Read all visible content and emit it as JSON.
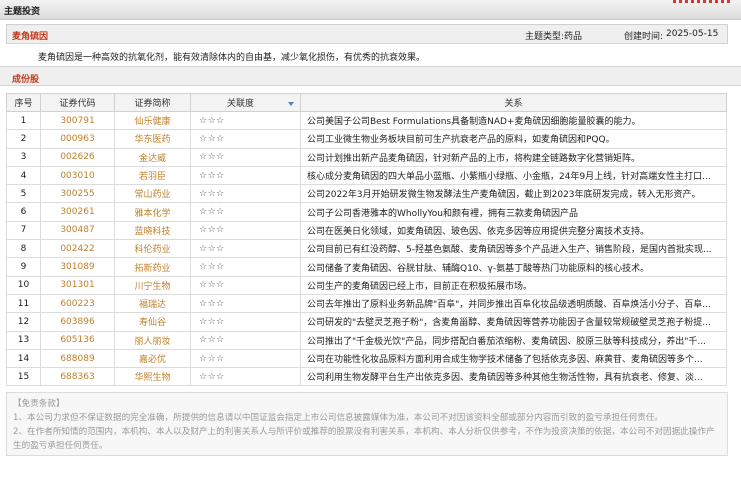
{
  "window": {
    "title": "主题投资"
  },
  "topic": {
    "name": "麦角硫因",
    "type_label": "主题类型:",
    "type_value": "药品",
    "date_label": "创建时间:",
    "date_value": "2025-05-15",
    "description": "麦角硫因是一种高效的抗氧化剂，能有效清除体内的自由基，减少氧化损伤，有优秀的抗衰效果。"
  },
  "components": {
    "section_title": "成份股",
    "columns": [
      "序号",
      "证券代码",
      "证券简称",
      "关联度",
      "关系"
    ],
    "rows": [
      {
        "no": "1",
        "code": "300791",
        "name": "仙乐健康",
        "stars": "☆☆☆",
        "relation": "公司美国子公司Best Formulations具备制造NAD+麦角硫因细胞能量胶囊的能力。"
      },
      {
        "no": "2",
        "code": "000963",
        "name": "华东医药",
        "stars": "☆☆☆",
        "relation": "公司工业微生物业务板块目前可生产抗衰老产品的原料，如麦角硫因和PQQ。"
      },
      {
        "no": "3",
        "code": "002626",
        "name": "金达威",
        "stars": "☆☆☆",
        "relation": "公司计划推出新产品麦角硫因，针对新产品的上市，将构建全链路数字化营销矩阵。"
      },
      {
        "no": "4",
        "code": "003010",
        "name": "若羽臣",
        "stars": "☆☆☆",
        "relation": "核心成分麦角硫因的四大单品小蓝瓶、小紫瓶小绿瓶、小金瓶，24年9月上线，针对高端女性主打口..."
      },
      {
        "no": "5",
        "code": "300255",
        "name": "常山药业",
        "stars": "☆☆☆",
        "relation": "公司2022年3月开始研发微生物发酵法生产麦角硫因，截止到2023年底研发完成，转入无形资产。"
      },
      {
        "no": "6",
        "code": "300261",
        "name": "雅本化学",
        "stars": "☆☆☆",
        "relation": "公司子公司香港雅本的WhollyYou和颜有裡，拥有三款麦角硫因产品"
      },
      {
        "no": "7",
        "code": "300487",
        "name": "蓝晓科技",
        "stars": "☆☆☆",
        "relation": "公司在医美日化领域，如麦角硫因、玻色因、依克多因等应用提供完整分离技术支持。"
      },
      {
        "no": "8",
        "code": "002422",
        "name": "科伦药业",
        "stars": "☆☆☆",
        "relation": "公司目前已有红没药醇、5-羟基色氨酸、麦角硫因等多个产品进入生产、销售阶段，是国内首批实现..."
      },
      {
        "no": "9",
        "code": "301089",
        "name": "拓新药业",
        "stars": "☆☆☆",
        "relation": "公司储备了麦角硫因、谷胱甘肽、辅酶Q10、γ-氨基丁酸等热门功能原料的核心技术。"
      },
      {
        "no": "10",
        "code": "301301",
        "name": "川宁生物",
        "stars": "☆☆☆",
        "relation": "公司生产的麦角硫因已经上市，目前正在积极拓展市场。"
      },
      {
        "no": "11",
        "code": "600223",
        "name": "福瑞达",
        "stars": "☆☆☆",
        "relation": "公司去年推出了原料业务新品牌\"百阜\"，并同步推出百阜化妆品级透明质酸、百阜焕活小分子、百阜..."
      },
      {
        "no": "12",
        "code": "603896",
        "name": "寿仙谷",
        "stars": "☆☆☆",
        "relation": "公司研发的\"去壁灵芝孢子粉\"，含麦角甾醇、麦角硫因等营养功能因子含量较常规破壁灵芝孢子粉提..."
      },
      {
        "no": "13",
        "code": "605136",
        "name": "丽人丽妆",
        "stars": "☆☆☆",
        "relation": "公司推出了\"千金极光饮\"产品，同步搭配白番茄浓缩粉、麦角硫因、胶原三肽等科技成分，养出\"千..."
      },
      {
        "no": "14",
        "code": "688089",
        "name": "嘉必优",
        "stars": "☆☆☆",
        "relation": "公司在功能性化妆品原料方面利用合成生物学技术储备了包括依克多因、麻黄苷、麦角硫因等多个..."
      },
      {
        "no": "15",
        "code": "688363",
        "name": "华熙生物",
        "stars": "☆☆☆",
        "relation": "公司利用生物发酵平台生产出依克多因、麦角硫因等多种其他生物活性物，具有抗衰老、修复、淡..."
      }
    ]
  },
  "disclaimer": {
    "heading": "【免责条款】",
    "line1": "1、本公司力求但不保证数据的完全准确，所提供的信息请以中国证监会指定上市公司信息披露媒体为准，本公司不对因该资料全部或部分内容而引致的盈亏承担任何责任。",
    "line2": "2、在作者所知情的范围内，本机构、本人以及财产上的利害关系人与所评价或推荐的股票没有利害关系，本机构、本人分析仅供参考，不作为投资决策的依据，本公司不对因据此操作产生的盈亏承担任何责任。"
  },
  "colors": {
    "accent_red": "#c43b1b",
    "link_orange": "#c0802b",
    "header_gray": "#efefef"
  }
}
